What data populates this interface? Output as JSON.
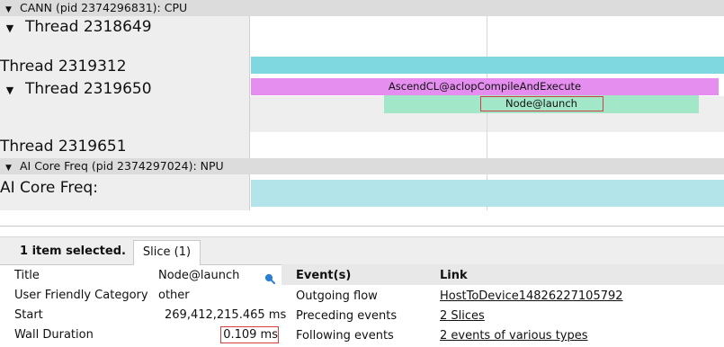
{
  "processes": [
    {
      "label": "CANN (pid 2374296831): CPU"
    },
    {
      "label": "AI Core Freq (pid 2374297024): NPU"
    }
  ],
  "threads": [
    {
      "label": "Thread 2318649",
      "expanded": true
    },
    {
      "label": "Thread 2319312"
    },
    {
      "label": "Thread 2319650",
      "expanded": true
    },
    {
      "label": "Thread 2319651"
    },
    {
      "label": "AI Core Freq:"
    }
  ],
  "slices": [
    {
      "label": "",
      "color": "#7fd8df"
    },
    {
      "label": "AscendCL@aclopCompileAndExecute",
      "color": "#e58ef0"
    },
    {
      "label": "Node@launch",
      "color": "#a3e7c9",
      "selected": true
    },
    {
      "label": "",
      "color": "#b2e4ea"
    }
  ],
  "panel": {
    "selection_summary": "1 item selected.",
    "tab_label": "Slice (1)"
  },
  "details": {
    "title_label": "Title",
    "title_value": "Node@launch",
    "category_label": "User Friendly Category",
    "category_value": "other",
    "start_label": "Start",
    "start_value": "269,412,215.465 ms",
    "duration_label": "Wall Duration",
    "duration_value": "0.109 ms",
    "search_icon": "magnifier-icon"
  },
  "events": {
    "header_events": "Event(s)",
    "header_link": "Link",
    "rows": [
      {
        "event": "Outgoing flow",
        "link": "HostToDevice14826227105792"
      },
      {
        "event": "Preceding events",
        "link": "2 Slices"
      },
      {
        "event": "Following events",
        "link": "2 events of various types"
      }
    ]
  },
  "colors": {
    "accent_highlight": "#d04040",
    "magnifier": "#2a7fd4"
  }
}
